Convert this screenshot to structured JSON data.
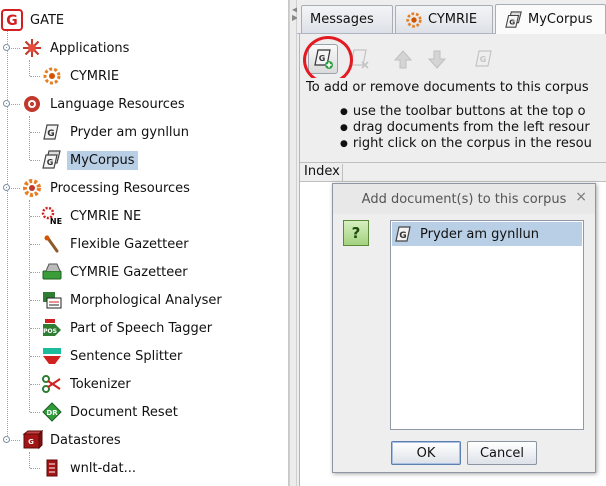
{
  "tree": {
    "root": "GATE",
    "applications": {
      "label": "Applications",
      "items": [
        "CYMRIE"
      ]
    },
    "language_resources": {
      "label": "Language Resources",
      "items": [
        "Pryder am gynllun",
        "MyCorpus"
      ]
    },
    "processing_resources": {
      "label": "Processing Resources",
      "items": [
        "CYMRIE NE",
        "Flexible Gazetteer",
        "CYMRIE Gazetteer",
        "Morphological Analyser",
        "Part of Speech Tagger",
        "Sentence Splitter",
        "Tokenizer",
        "Document Reset"
      ]
    },
    "datastores": {
      "label": "Datastores",
      "items": [
        "wnlt-dat..."
      ]
    },
    "selected": "MyCorpus"
  },
  "tabs": [
    "Messages",
    "CYMRIE",
    "MyCorpus"
  ],
  "active_tab": "MyCorpus",
  "instructions": {
    "title": "To add or remove documents to this corpus",
    "bullets": [
      "use the toolbar buttons at the top o",
      "drag documents from the left resour",
      "right click on the corpus in the resou"
    ]
  },
  "table": {
    "column": "Index"
  },
  "dialog": {
    "title": "Add document(s) to this corpus",
    "close": "×",
    "question_mark": "?",
    "items": [
      "Pryder am gynllun"
    ],
    "ok_label": "OK",
    "cancel_label": "Cancel"
  },
  "colors": {
    "selection": "#b8cfe5",
    "highlight_ring": "#e21b23",
    "gate_red": "#d21f1f"
  }
}
